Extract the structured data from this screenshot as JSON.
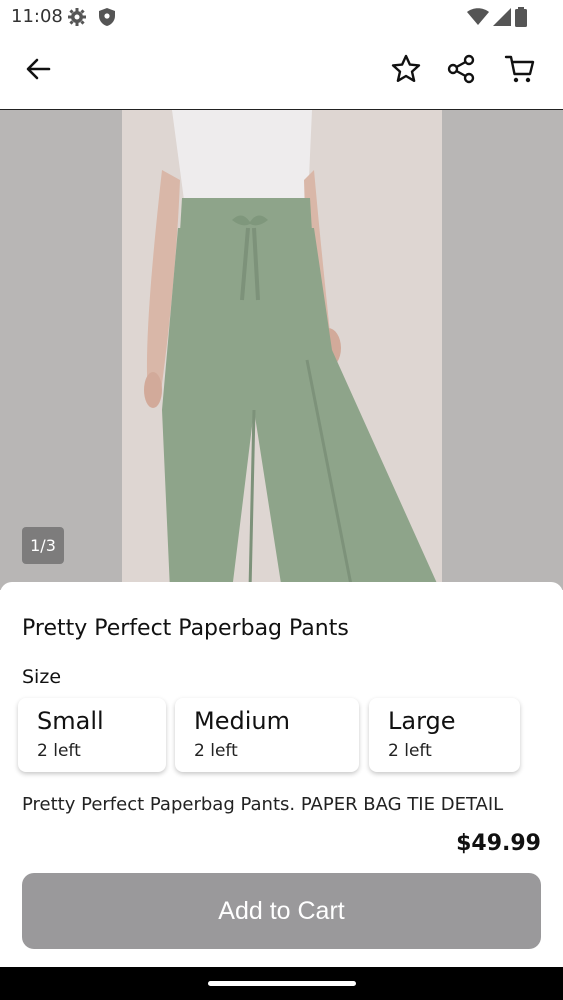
{
  "status_bar": {
    "time": "11:08",
    "icons": [
      "gear-icon",
      "shield-icon",
      "wifi-icon",
      "signal-icon",
      "battery-icon"
    ]
  },
  "app_bar": {
    "icons": [
      "back-arrow-icon",
      "star-icon",
      "share-icon",
      "cart-icon"
    ]
  },
  "gallery": {
    "counter": "1/3"
  },
  "product": {
    "title": "Pretty Perfect Paperbag Pants",
    "size_label": "Size",
    "sizes": [
      {
        "name": "Small",
        "stock": "2 left"
      },
      {
        "name": "Medium",
        "stock": "2 left"
      },
      {
        "name": "Large",
        "stock": "2 left"
      }
    ],
    "description": "Pretty Perfect Paperbag Pants. PAPER BAG TIE DETAIL",
    "price": "$49.99",
    "add_to_cart_label": "Add to Cart"
  },
  "colors": {
    "button_disabled": "#9a999b",
    "pants_green": "#8ea48a"
  }
}
